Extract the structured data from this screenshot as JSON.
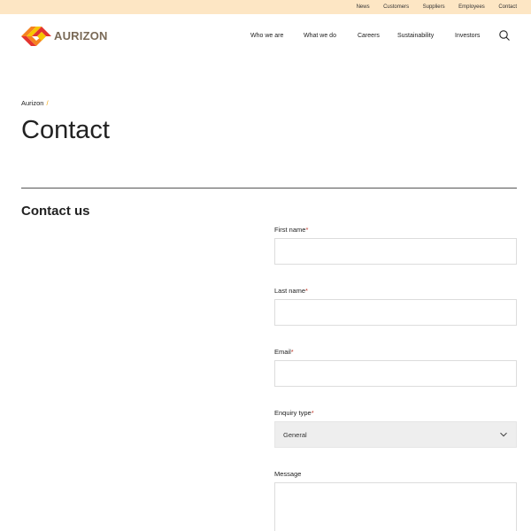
{
  "utility_nav": {
    "items": [
      {
        "label": "News"
      },
      {
        "label": "Customers"
      },
      {
        "label": "Suppliers"
      },
      {
        "label": "Employees"
      },
      {
        "label": "Contact"
      }
    ]
  },
  "brand": {
    "name": "AURIZON",
    "icon": "aurizon-logo-icon",
    "colors": {
      "red": "#e3342f",
      "orange": "#f58220",
      "yellow": "#f7c600",
      "wordmark": "#7a6a57"
    }
  },
  "main_nav": {
    "items": [
      {
        "label": "Who we are"
      },
      {
        "label": "What we do"
      },
      {
        "label": "Careers"
      },
      {
        "label": "Sustainability"
      },
      {
        "label": "Investors"
      }
    ],
    "search_icon": "search-icon"
  },
  "breadcrumb": {
    "home": "Aurizon",
    "separator": "/"
  },
  "page": {
    "title": "Contact"
  },
  "section": {
    "title": "Contact us"
  },
  "form": {
    "first_name": {
      "label": "First name",
      "required_mark": "*",
      "value": ""
    },
    "last_name": {
      "label": "Last name",
      "required_mark": "*",
      "value": ""
    },
    "email": {
      "label": "Email",
      "required_mark": "*",
      "value": ""
    },
    "enquiry_type": {
      "label": "Enquiry type",
      "required_mark": "*",
      "selected": "General"
    },
    "message": {
      "label": "Message",
      "value": ""
    }
  },
  "colors": {
    "utility_bar_bg": "#fde6c4",
    "breadcrumb_separator": "#f4a300",
    "select_bg": "#eeeeee"
  }
}
